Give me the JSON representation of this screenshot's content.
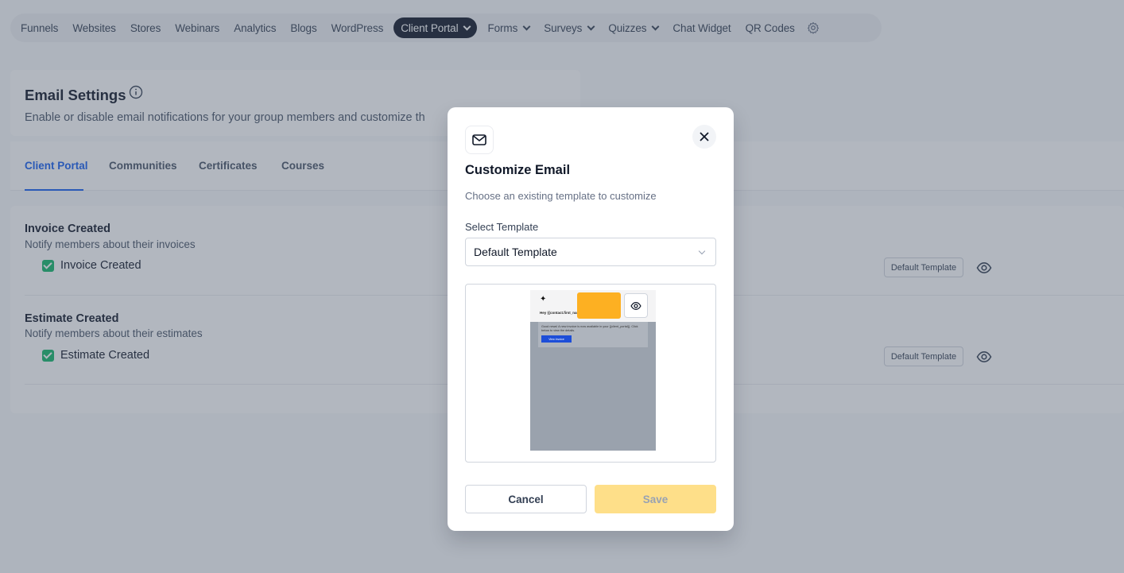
{
  "nav": {
    "items": [
      {
        "label": "Funnels",
        "dropdown": false
      },
      {
        "label": "Websites",
        "dropdown": false
      },
      {
        "label": "Stores",
        "dropdown": false
      },
      {
        "label": "Webinars",
        "dropdown": false
      },
      {
        "label": "Analytics",
        "dropdown": false
      },
      {
        "label": "Blogs",
        "dropdown": false
      },
      {
        "label": "WordPress",
        "dropdown": false
      },
      {
        "label": "Client Portal",
        "dropdown": true,
        "active": true
      },
      {
        "label": "Forms",
        "dropdown": true
      },
      {
        "label": "Surveys",
        "dropdown": true
      },
      {
        "label": "Quizzes",
        "dropdown": true
      },
      {
        "label": "Chat Widget",
        "dropdown": false
      },
      {
        "label": "QR Codes",
        "dropdown": false
      }
    ],
    "settings_icon": "gear-icon"
  },
  "settings": {
    "title": "Email Settings",
    "description": "Enable or disable email notifications for your group members and customize th"
  },
  "tabs": [
    {
      "label": "Client Portal",
      "active": true
    },
    {
      "label": "Communities"
    },
    {
      "label": "Certificates"
    },
    {
      "label": "Courses"
    }
  ],
  "rows": [
    {
      "title": "Invoice Created",
      "subtitle": "Notify members about their invoices",
      "checkbox_label": "Invoice Created",
      "checked": true,
      "template_button": "Default Template"
    },
    {
      "title": "Estimate Created",
      "subtitle": "Notify members about their estimates",
      "checkbox_label": "Estimate Created",
      "checked": true,
      "template_button": "Default Template"
    }
  ],
  "modal": {
    "title": "Customize Email",
    "subtitle": "Choose an existing template to customize",
    "select_label": "Select Template",
    "select_value": "Default Template",
    "preview": {
      "logo": "✦",
      "heading": "Hey {{contact.first_name}},",
      "body": "Good news! A new invoice is now available in your {{client_portal}}. Click below to view the details.",
      "button": "View Invoice"
    },
    "cancel_label": "Cancel",
    "save_label": "Save"
  },
  "colors": {
    "accent": "#155eef",
    "nav_active_bg": "#101828",
    "check": "#12b76a",
    "save_disabled_bg": "#fedf89",
    "highlight": "#fdb022"
  }
}
